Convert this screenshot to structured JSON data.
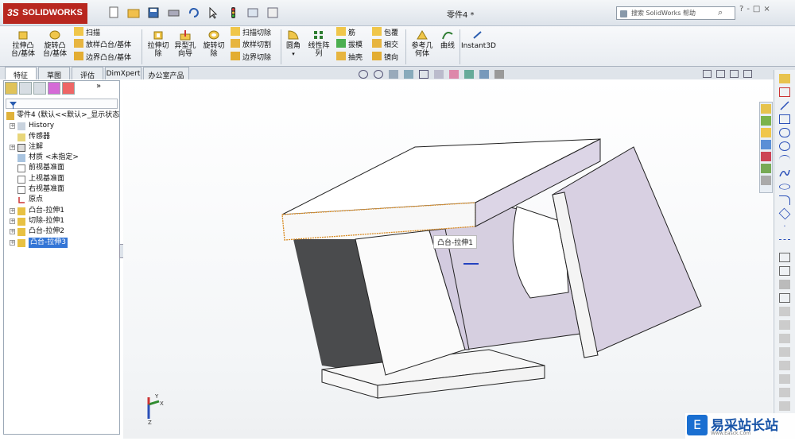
{
  "titlebar": {
    "app_logo": "SOLIDWORKS",
    "logo_prefix": "3S",
    "doc_title": "零件4 *",
    "search_placeholder": "搜索 SolidWorks 帮助",
    "search_icon": "search-icon",
    "window_controls": [
      "?",
      "-",
      "□",
      "×"
    ]
  },
  "ribbon": {
    "large": [
      {
        "label": "拉伸凸\n台/基体",
        "icon": "extrude-boss-icon"
      },
      {
        "label": "旋转凸\n台/基体",
        "icon": "revolve-boss-icon"
      },
      {
        "label": "拉伸切\n除",
        "icon": "extrude-cut-icon"
      },
      {
        "label": "异型孔\n向导",
        "icon": "hole-wizard-icon"
      },
      {
        "label": "旋转切\n除",
        "icon": "revolve-cut-icon"
      },
      {
        "label": "圆角",
        "icon": "fillet-icon"
      },
      {
        "label": "线性阵\n列",
        "icon": "linear-pattern-icon"
      },
      {
        "label": "参考几\n何体",
        "icon": "reference-geometry-icon"
      },
      {
        "label": "曲线",
        "icon": "curves-icon"
      },
      {
        "label": "Instant3D",
        "icon": "instant3d-icon"
      }
    ],
    "small_group1": [
      "扫描",
      "放样凸台/基体",
      "边界凸台/基体"
    ],
    "small_group2": [
      "扫描切除",
      "放样切割",
      "边界切除"
    ],
    "small_group3": [
      "筋",
      "拔模",
      "抽壳"
    ],
    "small_group4": [
      "包覆",
      "相交",
      "镜向"
    ]
  },
  "tabs": [
    "特征",
    "草图",
    "评估",
    "DimXpert",
    "办公室产品"
  ],
  "active_tab": "特征",
  "tree": {
    "root": "零件4  (默认<<默认>_显示状态",
    "items": [
      {
        "label": "History",
        "expand": true
      },
      {
        "label": "传感器",
        "expand": false
      },
      {
        "label": "注解",
        "expand": true
      },
      {
        "label": "材质 <未指定>",
        "expand": false
      },
      {
        "label": "前视基准面",
        "expand": false
      },
      {
        "label": "上视基准面",
        "expand": false
      },
      {
        "label": "右视基准面",
        "expand": false
      },
      {
        "label": "原点",
        "expand": false
      },
      {
        "label": "凸台-拉伸1",
        "expand": true
      },
      {
        "label": "切除-拉伸1",
        "expand": true
      },
      {
        "label": "凸台-拉伸2",
        "expand": true
      },
      {
        "label": "凸台-拉伸3",
        "expand": true,
        "selected": true
      }
    ]
  },
  "viewport": {
    "tooltip": "凸台-拉伸1",
    "triad": {
      "x": "X",
      "y": "Y",
      "z": "Z"
    }
  },
  "watermark": {
    "text": "易采站长站",
    "sub": "Www.Easck.Com"
  },
  "colors": {
    "accent": "#b8271f",
    "selection": "#3375d6",
    "model_face": "#ffffff",
    "model_purple": "#d9d0e3",
    "model_edge": "#222222"
  }
}
